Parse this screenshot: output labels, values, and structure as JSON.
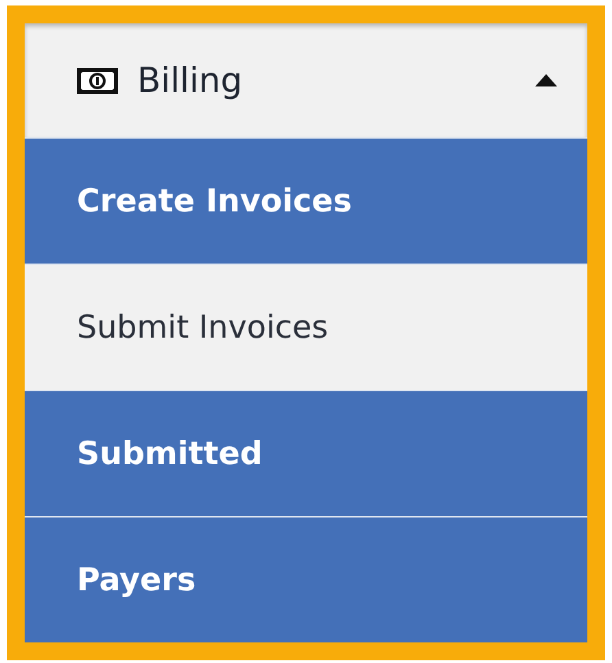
{
  "menu": {
    "title": "Billing",
    "expanded": true,
    "items": [
      {
        "label": "Create Invoices",
        "selected": false
      },
      {
        "label": "Submit Invoices",
        "selected": true
      },
      {
        "label": "Submitted",
        "selected": false
      },
      {
        "label": "Payers",
        "selected": false
      }
    ]
  }
}
